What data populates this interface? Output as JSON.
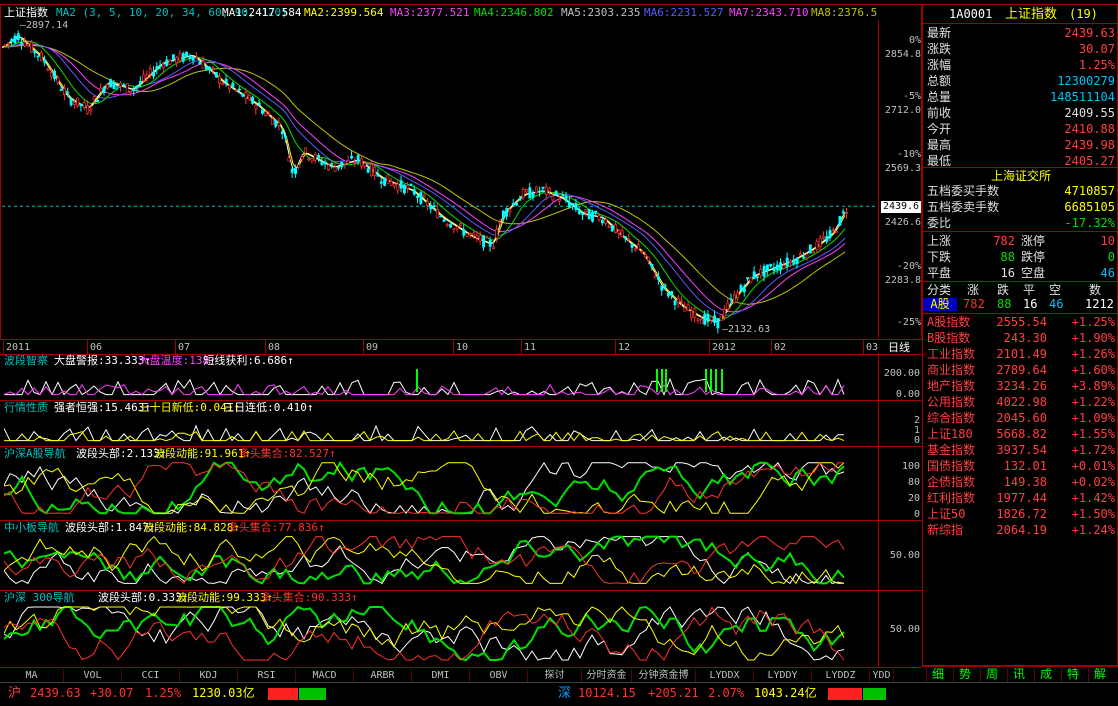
{
  "main": {
    "name": "上证指数",
    "ma_header": "MA2 (3, 5, 10, 20, 34, 60, 90, 120)",
    "ma": [
      {
        "label": "MA1:2417.584",
        "color": "#ffffff"
      },
      {
        "label": "MA2:2399.564",
        "color": "#ffff00"
      },
      {
        "label": "MA3:2377.521",
        "color": "#ff40ff"
      },
      {
        "label": "MA4:2346.802",
        "color": "#00e000"
      },
      {
        "label": "MA5:2303.235",
        "color": "#c0c0c0"
      },
      {
        "label": "MA6:2231.527",
        "color": "#5a5aff"
      },
      {
        "label": "MA7:2343.710",
        "color": "#ff40ff"
      },
      {
        "label": "MA8:2376.5",
        "color": "#c0c000"
      }
    ],
    "high_label": "2897.14",
    "low_label": "2132.63",
    "price_scale": [
      "0%",
      "2854.8",
      "-5%",
      "2712.0",
      "-10%",
      "2569.3",
      "2426.6",
      "-20%",
      "2283.8",
      "-25%"
    ],
    "current_price": "2439.6",
    "months": [
      "2011",
      "06",
      "07",
      "08",
      "09",
      "10",
      "11",
      "12",
      "2012",
      "02",
      "03"
    ],
    "period": "日线"
  },
  "panels": [
    {
      "name": "波段智察",
      "items": [
        {
          "label": "大盘警报:33.333",
          "color": "#ffffff"
        },
        {
          "label": "大盘温度:138",
          "color": "#ff40ff"
        },
        {
          "label": "短线获利:6.686",
          "color": "#ffffff"
        }
      ],
      "scale": [
        "200.00",
        "0.00"
      ]
    },
    {
      "name": "行情性质",
      "items": [
        {
          "label": "强者恒强:15.463",
          "color": "#ffffff"
        },
        {
          "label": "三十日新低:0.041",
          "color": "#ffff00"
        },
        {
          "label": "三日连低:0.410",
          "color": "#ffffff"
        }
      ],
      "scale": [
        "2",
        "1",
        "0"
      ]
    },
    {
      "name": "沪深A股导航",
      "items": [
        {
          "label": "波段头部:2.133",
          "color": "#ffffff"
        },
        {
          "label": "波段动能:91.961",
          "color": "#ffff00"
        },
        {
          "label": "多头集合:82.527",
          "color": "#ff3030"
        }
      ],
      "scale": [
        "100",
        "80",
        "20",
        "0"
      ]
    },
    {
      "name": "中小板导航",
      "items": [
        {
          "label": "波段头部:1.847",
          "color": "#ffffff"
        },
        {
          "label": "波段动能:84.828",
          "color": "#ffff00"
        },
        {
          "label": "多头集合:77.836",
          "color": "#ff3030"
        }
      ],
      "scale": [
        "50.00"
      ]
    },
    {
      "name": "沪深 300导航",
      "items": [
        {
          "label": "波段头部:0.333",
          "color": "#ffffff"
        },
        {
          "label": "波段动能:99.333",
          "color": "#ffff00"
        },
        {
          "label": "多头集合:90.333",
          "color": "#ff3030"
        }
      ],
      "scale": [
        "50.00"
      ]
    }
  ],
  "indicator_tabs": [
    "MA",
    "VOL",
    "CCI",
    "KDJ",
    "RSI",
    "MACD",
    "ARBR",
    "DMI",
    "OBV",
    "探讨",
    "分时资金博",
    "分钟资金博",
    "LYDDX",
    "LYDDY",
    "LYDDZ",
    "YDD"
  ],
  "right": {
    "code": "1A0001",
    "name": "上证指数",
    "count": "(19)",
    "quote": [
      {
        "label": "最新",
        "value": "2439.63",
        "color": "#ff4040"
      },
      {
        "label": "涨跌",
        "value": "30.07",
        "color": "#ff4040"
      },
      {
        "label": "涨幅",
        "value": "1.25%",
        "color": "#ff4040"
      },
      {
        "label": "总额",
        "value": "12300279",
        "color": "#00c0ff"
      },
      {
        "label": "总量",
        "value": "148511104",
        "color": "#00c0ff"
      },
      {
        "label": "前收",
        "value": "2409.55",
        "color": "#e0e0e0"
      },
      {
        "label": "今开",
        "value": "2410.88",
        "color": "#ff4040"
      },
      {
        "label": "最高",
        "value": "2439.98",
        "color": "#ff4040"
      },
      {
        "label": "最低",
        "value": "2405.27",
        "color": "#ff4040"
      }
    ],
    "exchange": "上海证交所",
    "orders": [
      {
        "label": "五档委买手数",
        "value": "4710857",
        "color": "#ffff00"
      },
      {
        "label": "五档委卖手数",
        "value": "6685105",
        "color": "#ffff00"
      },
      {
        "label": "委比",
        "value": "-17.32%",
        "color": "#00e000"
      }
    ],
    "breadth": [
      {
        "l1": "上涨",
        "v1": "782",
        "c1": "#ff4040",
        "l2": "涨停",
        "v2": "10",
        "c2": "#ff4040"
      },
      {
        "l1": "下跌",
        "v1": "88",
        "c1": "#00e000",
        "l2": "跌停",
        "v2": "0",
        "c2": "#00e000"
      },
      {
        "l1": "平盘",
        "v1": "16",
        "c1": "#e0e0e0",
        "l2": "空盘",
        "v2": "46",
        "c2": "#00c0ff"
      }
    ],
    "cls_header": [
      "分类",
      "涨",
      "跌",
      "平",
      "空",
      "数"
    ],
    "cls_row": {
      "name": "A股",
      "up": "782",
      "down": "88",
      "flat": "16",
      "empty": "46",
      "total": "1212"
    },
    "indices": [
      {
        "name": "A股指数",
        "price": "2555.54",
        "chg": "+1.25%"
      },
      {
        "name": "B股指数",
        "price": "243.30",
        "chg": "+1.90%"
      },
      {
        "name": "工业指数",
        "price": "2101.49",
        "chg": "+1.26%"
      },
      {
        "name": "商业指数",
        "price": "2789.64",
        "chg": "+1.60%"
      },
      {
        "name": "地产指数",
        "price": "3234.26",
        "chg": "+3.89%"
      },
      {
        "name": "公用指数",
        "price": "4022.98",
        "chg": "+1.22%"
      },
      {
        "name": "综合指数",
        "price": "2045.60",
        "chg": "+1.09%"
      },
      {
        "name": "上证180",
        "price": "5668.82",
        "chg": "+1.55%"
      },
      {
        "name": "基金指数",
        "price": "3937.54",
        "chg": "+1.72%"
      },
      {
        "name": "国债指数",
        "price": "132.01",
        "chg": "+0.01%"
      },
      {
        "name": "企债指数",
        "price": "149.38",
        "chg": "+0.02%"
      },
      {
        "name": "红利指数",
        "price": "1977.44",
        "chg": "+1.42%"
      },
      {
        "name": "上证50",
        "price": "1826.72",
        "chg": "+1.50%"
      },
      {
        "name": "新综指",
        "price": "2064.19",
        "chg": "+1.24%"
      }
    ],
    "tabs": [
      "细",
      "势",
      "周",
      "讯",
      "成",
      "特",
      "解"
    ]
  },
  "status": {
    "sh": {
      "mark": "沪",
      "price": "2439.63",
      "chg": "+30.07",
      "pct": "1.25%",
      "amount": "1230.03亿"
    },
    "sz": {
      "mark": "深",
      "price": "10124.15",
      "chg": "+205.21",
      "pct": "2.07%",
      "amount": "1043.24亿"
    }
  }
}
